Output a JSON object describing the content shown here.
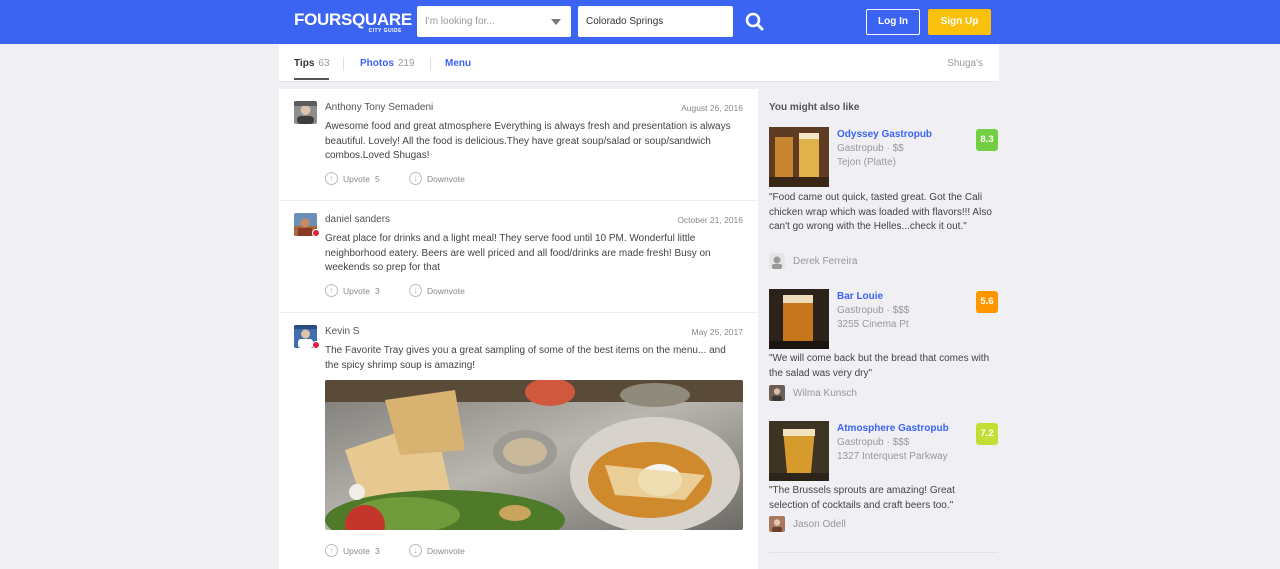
{
  "header": {
    "logo_word": "FOURSQUARE",
    "logo_sub": "CITY GUIDE",
    "search_placeholder": "I'm looking for...",
    "location_value": "Colorado Springs",
    "login_label": "Log In",
    "signup_label": "Sign Up",
    "brand_color": "#3b64f3",
    "signup_color": "#f9c00c"
  },
  "tabs": {
    "tips_label": "Tips",
    "tips_count": "63",
    "photos_label": "Photos",
    "photos_count": "219",
    "menu_label": "Menu",
    "venue_name": "Shuga's"
  },
  "tips": [
    {
      "author": "Anthony Tony Semadeni",
      "date": "August 26, 2016",
      "text": "Awesome food and great atmosphere Everything is always fresh and presentation is always beautiful. Lovely! All the food is delicious.They have great soup/salad or soup/sandwich combos.Loved Shugas!",
      "upvote_label": "Upvote",
      "upvotes": "5",
      "downvote_label": "Downvote"
    },
    {
      "author": "daniel sanders",
      "date": "October 21, 2016",
      "text": "Great place for drinks and a light meal! They serve food until 10 PM. Wonderful little neighborhood eatery. Beers are well priced and all food/drinks are made fresh! Busy on weekends so prep for that",
      "upvote_label": "Upvote",
      "upvotes": "3",
      "downvote_label": "Downvote"
    },
    {
      "author": "Kevin S",
      "date": "May 25, 2017",
      "text": "The Favorite Tray gives you a great sampling of some of the best items on the menu... and the spicy shrimp soup is amazing!",
      "upvote_label": "Upvote",
      "upvotes": "3",
      "downvote_label": "Downvote"
    }
  ],
  "sidebar": {
    "title": "You might also like",
    "recs": [
      {
        "name": "Odyssey Gastropub",
        "category": "Gastropub · $$",
        "location": "Tejon (Platte)",
        "score": "8.3",
        "score_color": "#73cf42",
        "quote": "\"Food came out quick, tasted great. Got the Cali chicken wrap which was loaded with flavors!!! Also can't go wrong with the Helles...check it out.\"",
        "user": "Derek Ferreira"
      },
      {
        "name": "Bar Louie",
        "category": "Gastropub · $$$",
        "location": "3255 Cinema Pt",
        "score": "5.6",
        "score_color": "#ff9600",
        "quote": "\"We will come back but the bread that comes with the salad was very dry\"",
        "user": "Wilma Kunsch"
      },
      {
        "name": "Atmosphere Gastropub",
        "category": "Gastropub · $$$",
        "location": "1327 Interquest Parkway",
        "score": "7.2",
        "score_color": "#c5de35",
        "quote": "\"The Brussels sprouts are amazing! Great selection of cocktails and craft beers too.\"",
        "user": "Jason Odell"
      }
    ]
  }
}
